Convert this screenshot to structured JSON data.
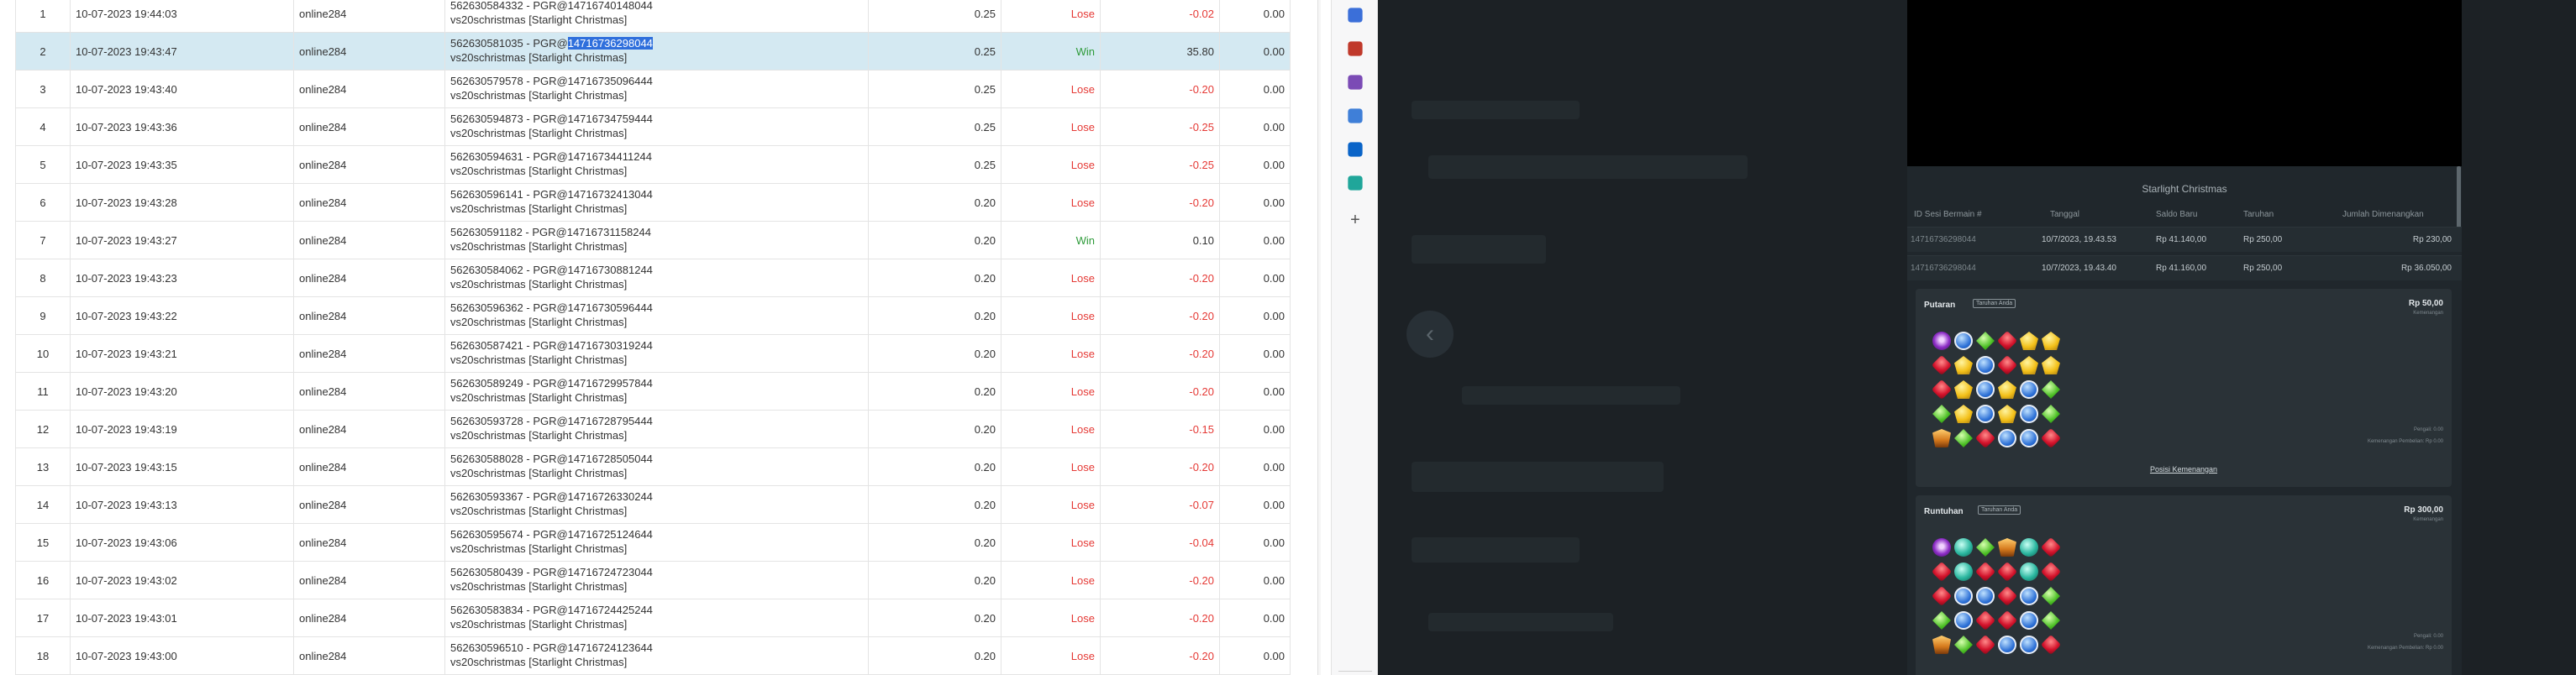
{
  "table": {
    "rows": [
      {
        "no": "1",
        "date": "10-07-2023 19:44:03",
        "user": "online284",
        "ref_id": "562630584332 - PGR@14716740148044",
        "ref_game": "vs20schristmas [Starlight Christmas]",
        "bet": "0.25",
        "result": "Lose",
        "winlose": "-0.02",
        "balance": "0.00",
        "selected": false
      },
      {
        "no": "2",
        "date": "10-07-2023 19:43:47",
        "user": "online284",
        "ref_id": "562630581035 - PGR@",
        "ref_id_selected": "14716736298044",
        "ref_game": "vs20schristmas [Starlight Christmas]",
        "bet": "0.25",
        "result": "Win",
        "winlose": "35.80",
        "balance": "0.00",
        "selected": true
      },
      {
        "no": "3",
        "date": "10-07-2023 19:43:40",
        "user": "online284",
        "ref_id": "562630579578 - PGR@14716735096444",
        "ref_game": "vs20schristmas [Starlight Christmas]",
        "bet": "0.25",
        "result": "Lose",
        "winlose": "-0.20",
        "balance": "0.00",
        "selected": false
      },
      {
        "no": "4",
        "date": "10-07-2023 19:43:36",
        "user": "online284",
        "ref_id": "562630594873 - PGR@14716734759444",
        "ref_game": "vs20schristmas [Starlight Christmas]",
        "bet": "0.25",
        "result": "Lose",
        "winlose": "-0.25",
        "balance": "0.00",
        "selected": false
      },
      {
        "no": "5",
        "date": "10-07-2023 19:43:35",
        "user": "online284",
        "ref_id": "562630594631 - PGR@14716734411244",
        "ref_game": "vs20schristmas [Starlight Christmas]",
        "bet": "0.25",
        "result": "Lose",
        "winlose": "-0.25",
        "balance": "0.00",
        "selected": false
      },
      {
        "no": "6",
        "date": "10-07-2023 19:43:28",
        "user": "online284",
        "ref_id": "562630596141 - PGR@14716732413044",
        "ref_game": "vs20schristmas [Starlight Christmas]",
        "bet": "0.20",
        "result": "Lose",
        "winlose": "-0.20",
        "balance": "0.00",
        "selected": false
      },
      {
        "no": "7",
        "date": "10-07-2023 19:43:27",
        "user": "online284",
        "ref_id": "562630591182 - PGR@14716731158244",
        "ref_game": "vs20schristmas [Starlight Christmas]",
        "bet": "0.20",
        "result": "Win",
        "winlose": "0.10",
        "balance": "0.00",
        "selected": false
      },
      {
        "no": "8",
        "date": "10-07-2023 19:43:23",
        "user": "online284",
        "ref_id": "562630584062 - PGR@14716730881244",
        "ref_game": "vs20schristmas [Starlight Christmas]",
        "bet": "0.20",
        "result": "Lose",
        "winlose": "-0.20",
        "balance": "0.00",
        "selected": false
      },
      {
        "no": "9",
        "date": "10-07-2023 19:43:22",
        "user": "online284",
        "ref_id": "562630596362 - PGR@14716730596444",
        "ref_game": "vs20schristmas [Starlight Christmas]",
        "bet": "0.20",
        "result": "Lose",
        "winlose": "-0.20",
        "balance": "0.00",
        "selected": false
      },
      {
        "no": "10",
        "date": "10-07-2023 19:43:21",
        "user": "online284",
        "ref_id": "562630587421 - PGR@14716730319244",
        "ref_game": "vs20schristmas [Starlight Christmas]",
        "bet": "0.20",
        "result": "Lose",
        "winlose": "-0.20",
        "balance": "0.00",
        "selected": false
      },
      {
        "no": "11",
        "date": "10-07-2023 19:43:20",
        "user": "online284",
        "ref_id": "562630589249 - PGR@14716729957844",
        "ref_game": "vs20schristmas [Starlight Christmas]",
        "bet": "0.20",
        "result": "Lose",
        "winlose": "-0.20",
        "balance": "0.00",
        "selected": false
      },
      {
        "no": "12",
        "date": "10-07-2023 19:43:19",
        "user": "online284",
        "ref_id": "562630593728 - PGR@14716728795444",
        "ref_game": "vs20schristmas [Starlight Christmas]",
        "bet": "0.20",
        "result": "Lose",
        "winlose": "-0.15",
        "balance": "0.00",
        "selected": false
      },
      {
        "no": "13",
        "date": "10-07-2023 19:43:15",
        "user": "online284",
        "ref_id": "562630588028 - PGR@14716728505044",
        "ref_game": "vs20schristmas [Starlight Christmas]",
        "bet": "0.20",
        "result": "Lose",
        "winlose": "-0.20",
        "balance": "0.00",
        "selected": false
      },
      {
        "no": "14",
        "date": "10-07-2023 19:43:13",
        "user": "online284",
        "ref_id": "562630593367 - PGR@14716726330244",
        "ref_game": "vs20schristmas [Starlight Christmas]",
        "bet": "0.20",
        "result": "Lose",
        "winlose": "-0.07",
        "balance": "0.00",
        "selected": false
      },
      {
        "no": "15",
        "date": "10-07-2023 19:43:06",
        "user": "online284",
        "ref_id": "562630595674 - PGR@14716725124644",
        "ref_game": "vs20schristmas [Starlight Christmas]",
        "bet": "0.20",
        "result": "Lose",
        "winlose": "-0.04",
        "balance": "0.00",
        "selected": false
      },
      {
        "no": "16",
        "date": "10-07-2023 19:43:02",
        "user": "online284",
        "ref_id": "562630580439 - PGR@14716724723044",
        "ref_game": "vs20schristmas [Starlight Christmas]",
        "bet": "0.20",
        "result": "Lose",
        "winlose": "-0.20",
        "balance": "0.00",
        "selected": false
      },
      {
        "no": "17",
        "date": "10-07-2023 19:43:01",
        "user": "online284",
        "ref_id": "562630583834 - PGR@14716724425244",
        "ref_game": "vs20schristmas [Starlight Christmas]",
        "bet": "0.20",
        "result": "Lose",
        "winlose": "-0.20",
        "balance": "0.00",
        "selected": false
      },
      {
        "no": "18",
        "date": "10-07-2023 19:43:00",
        "user": "online284",
        "ref_id": "562630596510 - PGR@14716724123644",
        "ref_game": "vs20schristmas [Starlight Christmas]",
        "bet": "0.20",
        "result": "Lose",
        "winlose": "-0.20",
        "balance": "0.00",
        "selected": false
      }
    ]
  },
  "sidebar": {
    "icons": [
      {
        "name": "tag-icon",
        "color": "#3b6fd9"
      },
      {
        "name": "briefcase-icon",
        "color": "#c0392b"
      },
      {
        "name": "chess-pieces-icon",
        "color": "#7b4bb5"
      },
      {
        "name": "copilot-icon",
        "color": "#3f7fd8"
      },
      {
        "name": "outlook-icon",
        "color": "#0a64c8"
      },
      {
        "name": "send-icon",
        "color": "#20a69a"
      }
    ],
    "add_icon": "+"
  },
  "dark_area": {
    "back_icon": "‹"
  },
  "history": {
    "title": "Starlight Christmas",
    "headers": [
      "ID Sesi Bermain #",
      "Tanggal",
      "Saldo Baru",
      "Taruhan",
      "Jumlah Dimenangkan"
    ],
    "rows": [
      {
        "id": "14716736298044",
        "date": "10/7/2023, 19.43.53",
        "balance": "Rp 41.140,00",
        "bet": "Rp 250,00",
        "won": "Rp 230,00"
      },
      {
        "id": "14716736298044",
        "date": "10/7/2023, 19.43.40",
        "balance": "Rp 41.160,00",
        "bet": "Rp 250,00",
        "won": "Rp 36.050,00"
      }
    ],
    "spins": [
      {
        "title": "Putaran",
        "badge": "Taruhan Anda",
        "amount": "Rp 50,00",
        "sub": "Kemenangan",
        "grid": [
          [
            "purple",
            "blue",
            "green",
            "red",
            "yellow",
            "yellow"
          ],
          [
            "red",
            "yellow",
            "blue",
            "red",
            "yellow",
            "yellow"
          ],
          [
            "red",
            "yellow",
            "blue",
            "yellow",
            "blue",
            "green"
          ],
          [
            "green",
            "yellow",
            "blue",
            "yellow",
            "blue",
            "green"
          ],
          [
            "orange",
            "green",
            "red",
            "blue",
            "blue",
            "red"
          ]
        ],
        "notes": [
          "Pengali: 0.00",
          "Kemenangan Pembelian: Rp 0.00"
        ],
        "link": "Posisi Kemenangan"
      },
      {
        "title": "Runtuhan",
        "badge": "Taruhan Anda",
        "amount": "Rp 300,00",
        "sub": "Kemenangan",
        "grid": [
          [
            "purple",
            "teal",
            "green",
            "orange",
            "teal",
            "red"
          ],
          [
            "red",
            "teal",
            "red",
            "red",
            "teal",
            "red"
          ],
          [
            "red",
            "blue",
            "blue",
            "red",
            "blue",
            "green"
          ],
          [
            "green",
            "blue",
            "red",
            "red",
            "blue",
            "green"
          ],
          [
            "orange",
            "green",
            "red",
            "blue",
            "blue",
            "red"
          ]
        ],
        "notes": [
          "Pengali: 0.00",
          "Kemenangan Pembelian: Rp 0.00"
        ],
        "link": ""
      }
    ]
  }
}
